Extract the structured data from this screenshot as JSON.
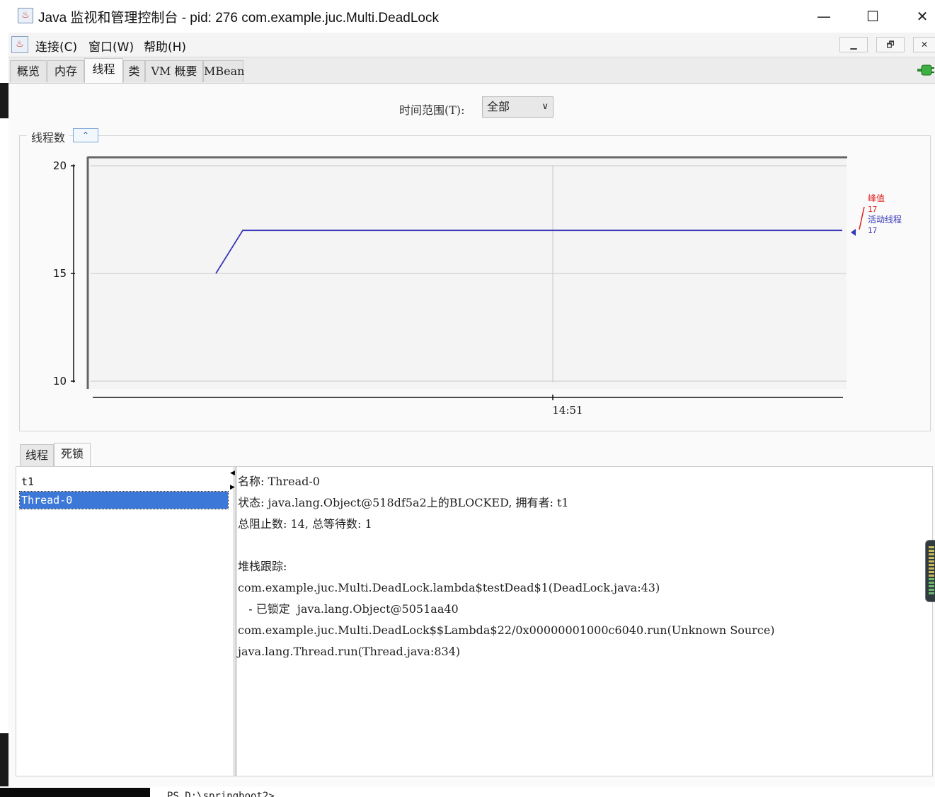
{
  "window": {
    "title": "Java 监视和管理控制台 - pid: 276 com.example.juc.Multi.DeadLock",
    "minimize_glyph": "—",
    "maximize_glyph": "☐",
    "close_glyph": "✕"
  },
  "menubar": {
    "items": [
      "连接(C)",
      "窗口(W)",
      "帮助(H)"
    ],
    "mdi_minimize": "▁",
    "mdi_restore": "🗗",
    "mdi_close": "✕"
  },
  "tabs": [
    {
      "label": "概览",
      "active": false
    },
    {
      "label": "内存",
      "active": false
    },
    {
      "label": "线程",
      "active": true
    },
    {
      "label": "类",
      "active": false
    },
    {
      "label": "VM 概要",
      "active": false
    },
    {
      "label": "MBean",
      "active": false
    }
  ],
  "time_range": {
    "label": "时间范围(T):",
    "selected": "全部"
  },
  "chart_panel": {
    "title": "线程数",
    "collapse_glyph": "⌃"
  },
  "chart_data": {
    "type": "line",
    "title": "线程数",
    "ylim": [
      10,
      20
    ],
    "y_ticks": [
      10,
      15,
      20
    ],
    "x_tick_labels": [
      "14:51"
    ],
    "series": [
      {
        "name": "活动线程",
        "color": "#3636b8",
        "x_frac": [
          0.165,
          0.2,
          1.0
        ],
        "values": [
          15,
          17,
          17
        ]
      }
    ],
    "legend": [
      {
        "name": "峰值",
        "value": "17",
        "color": "#e02020"
      },
      {
        "name": "活动线程",
        "value": "17",
        "color": "#3636b8"
      }
    ],
    "grid": true,
    "legend_position": "right"
  },
  "subtabs": [
    {
      "label": "线程",
      "active": false
    },
    {
      "label": "死锁",
      "active": true
    }
  ],
  "threads": [
    {
      "name": "t1",
      "selected": false
    },
    {
      "name": "Thread-0",
      "selected": true
    }
  ],
  "detail": {
    "name_line": "名称:  Thread-0",
    "state_line": "状态:  java.lang.Object@518df5a2上的BLOCKED,  拥有者:  t1",
    "counts_line": "总阻止数:  14,  总等待数:  1",
    "stack_label": "堆栈跟踪:",
    "stack": [
      "com.example.juc.Multi.DeadLock.lambda$testDead$1(DeadLock.java:43)",
      "   - 已锁定  java.lang.Object@5051aa40",
      "com.example.juc.Multi.DeadLock$$Lambda$22/0x00000001000c6040.run(Unknown Source)",
      "java.lang.Thread.run(Thread.java:834)"
    ]
  },
  "terminal": {
    "text": "PS D:\\springboot2>"
  },
  "colors": {
    "accent": "#3b78d8",
    "series_active": "#3636b8",
    "series_peak": "#e02020"
  }
}
